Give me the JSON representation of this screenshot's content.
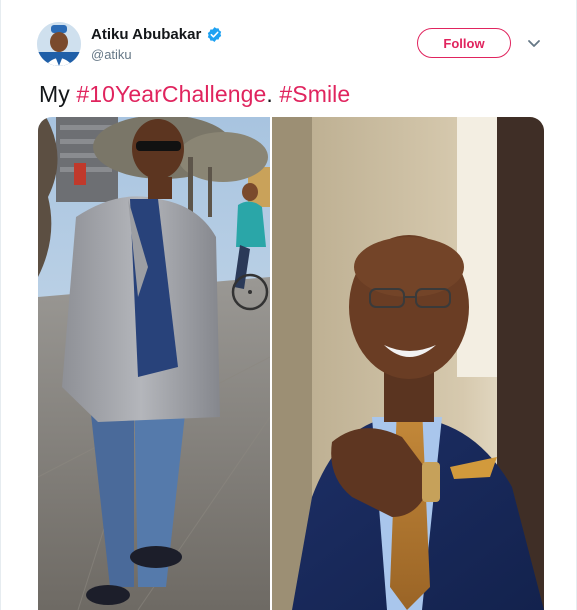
{
  "tweet": {
    "author": {
      "display_name": "Atiku Abubakar",
      "handle": "@atiku",
      "verified": true,
      "verified_icon": "verified-badge-icon"
    },
    "follow_label": "Follow",
    "menu_icon": "chevron-down-icon",
    "text_parts": {
      "prefix": "My ",
      "hashtag1": "#10YearChallenge",
      "middle": ". ",
      "hashtag2": "#Smile"
    },
    "media": {
      "count": 2
    }
  },
  "colors": {
    "accent": "#e0245e",
    "verified": "#1da1f2",
    "text": "#14171a",
    "secondary": "#657786"
  }
}
